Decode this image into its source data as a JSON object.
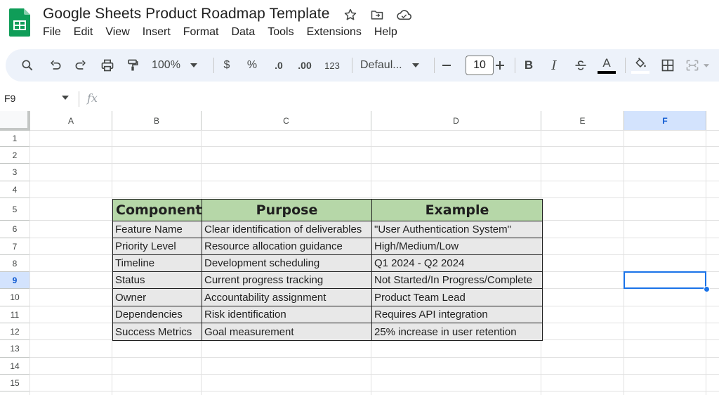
{
  "app": {
    "title": "Google Sheets Product Roadmap Template",
    "menus": [
      "File",
      "Edit",
      "View",
      "Insert",
      "Format",
      "Data",
      "Tools",
      "Extensions",
      "Help"
    ]
  },
  "toolbar": {
    "zoom": "100%",
    "currency": "$",
    "percent": "%",
    "decrease_decimals": ".0",
    "increase_decimals": ".00",
    "number_format": "123",
    "font": "Defaul...",
    "font_size": "10",
    "bold": "B",
    "italic": "I",
    "text_color_glyph": "A",
    "icons": [
      "search-icon",
      "undo-icon",
      "redo-icon",
      "print-icon",
      "paint-format-icon",
      "minus-icon",
      "plus-icon",
      "strikethrough-icon",
      "fill-color-icon",
      "borders-icon",
      "merge-cells-icon"
    ]
  },
  "formula_bar": {
    "name_box": "F9",
    "fx": "fx",
    "value": ""
  },
  "grid": {
    "columns": [
      "A",
      "B",
      "C",
      "D",
      "E",
      "F"
    ],
    "rows": [
      "1",
      "2",
      "3",
      "4",
      "5",
      "6",
      "7",
      "8",
      "9",
      "10",
      "11",
      "12",
      "13",
      "14",
      "15"
    ],
    "selected_cell": "F9",
    "selected_column": "F",
    "selected_row": "9"
  },
  "table": {
    "headers": [
      "Component",
      "Purpose",
      "Example"
    ],
    "rows": [
      [
        "Feature Name",
        "Clear identification of deliverables",
        "\"User Authentication System\""
      ],
      [
        "Priority Level",
        "Resource allocation guidance",
        "High/Medium/Low"
      ],
      [
        "Timeline",
        "Development scheduling",
        "Q1 2024 - Q2 2024"
      ],
      [
        "Status",
        "Current progress tracking",
        "Not Started/In Progress/Complete"
      ],
      [
        "Owner",
        "Accountability assignment",
        "Product Team Lead"
      ],
      [
        "Dependencies",
        "Risk identification",
        "Requires API integration"
      ],
      [
        "Success Metrics",
        "Goal measurement",
        "25% increase in user retention"
      ]
    ]
  },
  "colors": {
    "header_fill": "#b6d7a8",
    "body_fill": "#e8e8e8",
    "selection": "#1a73e8",
    "sheets_green": "#0f9d58"
  }
}
